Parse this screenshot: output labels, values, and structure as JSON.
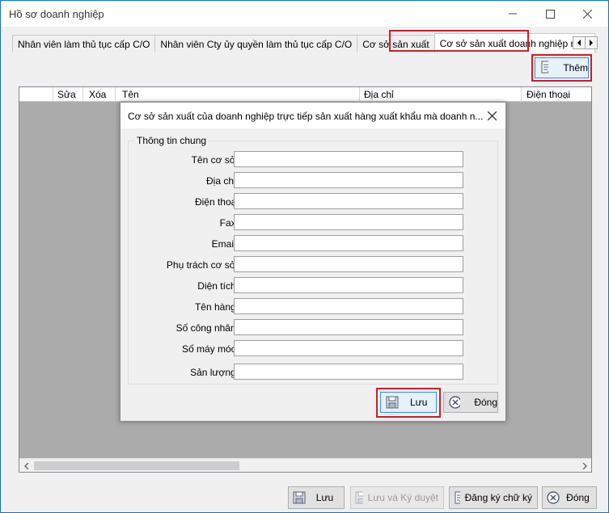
{
  "window": {
    "title": "Hồ sơ doanh nghiệp"
  },
  "tabs": [
    {
      "label": "Nhân viên làm thủ tục cấp C/O"
    },
    {
      "label": "Nhân viên Cty ủy quyền làm thủ tục cấp C/O"
    },
    {
      "label": "Cơ sở sản xuất"
    },
    {
      "label": "Cơ sở sản xuất doanh nghiệp mua",
      "active": true
    }
  ],
  "toolbar": {
    "add_label": "Thêm"
  },
  "grid": {
    "columns": [
      "Sửa",
      "Xóa",
      "Tên",
      "Địa chỉ",
      "Điện thoại"
    ]
  },
  "dialog": {
    "title": "Cơ sở sản xuất của doanh nghiệp trực tiếp sản xuất hàng xuất khẩu mà doanh n...",
    "group_title": "Thông tin chung",
    "fields": [
      {
        "label": "Tên cơ sở:",
        "value": ""
      },
      {
        "label": "Địa chỉ:",
        "value": ""
      },
      {
        "label": "Điện thoại",
        "value": ""
      },
      {
        "label": "Fax:",
        "value": ""
      },
      {
        "label": "Email:",
        "value": ""
      },
      {
        "label": "Phụ trách cơ sở:",
        "value": ""
      },
      {
        "label": "Diện tích:",
        "value": ""
      },
      {
        "label": "Tên hàng:",
        "value": ""
      },
      {
        "label": "Số công nhân:",
        "value": ""
      },
      {
        "label": "Số máy móc:",
        "value": ""
      },
      {
        "label": "Sản lượng:",
        "value": ""
      }
    ],
    "save_label": "Lưu",
    "close_label": "Đóng"
  },
  "bottom": {
    "save_label": "Lưu",
    "save_approve_label": "Lưu và Ký duyệt",
    "register_signature_label": "Đăng ký chữ ký",
    "close_label": "Đóng"
  },
  "colors": {
    "highlight": "#c8202a",
    "accent": "#3a8ee6",
    "grid_bg": "#ababab"
  }
}
